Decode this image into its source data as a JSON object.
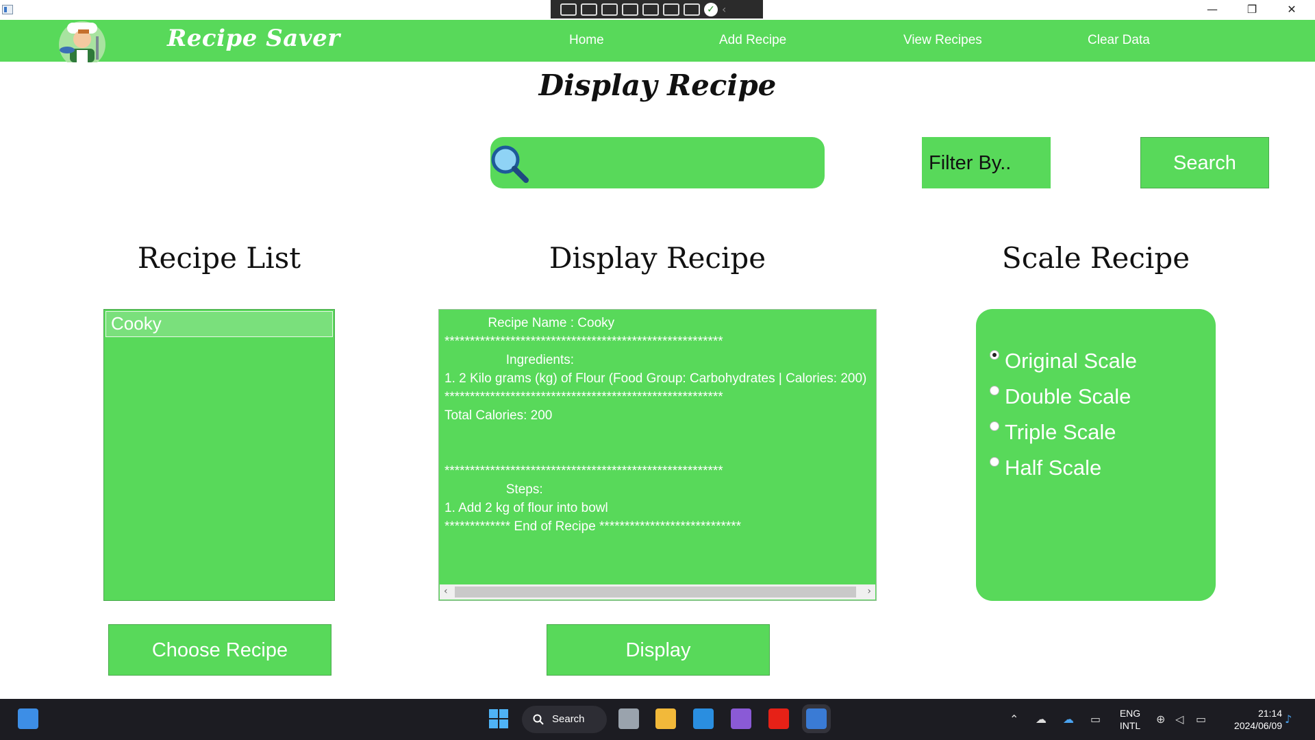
{
  "window": {
    "minimize": "—",
    "maximize": "❐",
    "close": "✕"
  },
  "nav": {
    "brand": "Recipe Saver",
    "links": [
      "Home",
      "Add Recipe",
      "View Recipes",
      "Clear Data"
    ]
  },
  "page_title": "Display Recipe",
  "search": {
    "query": "",
    "filter_label": "Filter By..",
    "button_label": "Search"
  },
  "sections": {
    "list_heading": "Recipe List",
    "display_heading": "Display Recipe",
    "scale_heading": "Scale Recipe"
  },
  "recipe_list": {
    "items": [
      "Cooky"
    ],
    "selected": "Cooky"
  },
  "display_text": {
    "lines": [
      "            Recipe Name : Cooky",
      "*******************************************************",
      "                 Ingredients:",
      "1. 2 Kilo grams (kg) of Flour (Food Group: Carbohydrates | Calories: 200)",
      "*******************************************************",
      "Total Calories: 200",
      "",
      "",
      "*******************************************************",
      "                 Steps:",
      "1. Add 2 kg of flour into bowl",
      "************* End of Recipe ****************************"
    ]
  },
  "scale": {
    "options": [
      "Original Scale",
      "Double Scale",
      "Triple Scale",
      "Half Scale"
    ],
    "selected": "Original Scale"
  },
  "buttons": {
    "choose": "Choose Recipe",
    "display": "Display"
  },
  "taskbar": {
    "search_label": "Search",
    "lang_top": "ENG",
    "lang_bottom": "INTL",
    "time": "21:14",
    "date": "2024/06/09"
  },
  "colors": {
    "accent_green": "#58d95a",
    "selected_item": "#7ae07c",
    "taskbar": "#1c1c22"
  }
}
